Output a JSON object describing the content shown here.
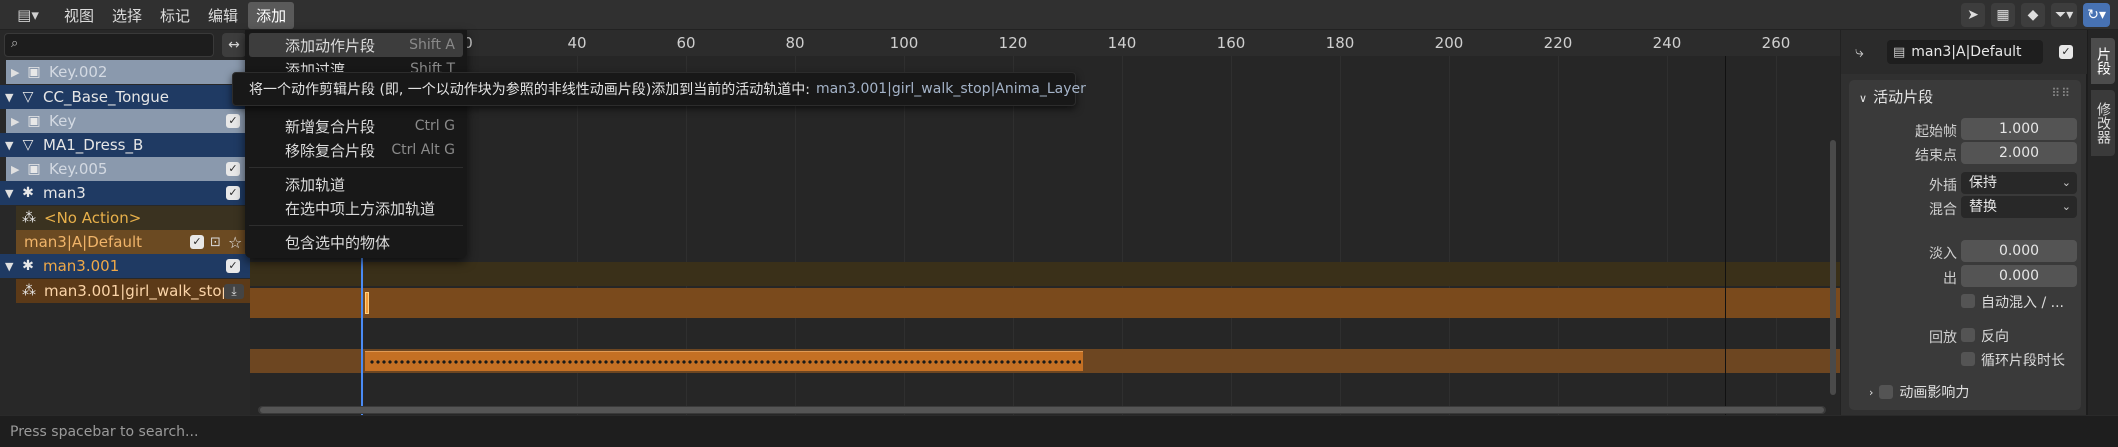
{
  "menubar": {
    "items": [
      "视图",
      "选择",
      "标记",
      "编辑",
      "添加"
    ]
  },
  "channels": {
    "rows": [
      {
        "label": "Key.002"
      },
      {
        "label": "CC_Base_Tongue"
      },
      {
        "label": "Key"
      },
      {
        "label": "MA1_Dress_B"
      },
      {
        "label": "Key.005"
      },
      {
        "label": "man3"
      },
      {
        "label": "<No Action>"
      },
      {
        "label": "man3|A|Default"
      },
      {
        "label": "man3.001"
      },
      {
        "label": "man3.001|girl_walk_stop|Ai"
      }
    ]
  },
  "ruler": {
    "ticks": [
      "0",
      "40",
      "60",
      "80",
      "100",
      "120",
      "140",
      "160",
      "180",
      "200",
      "220",
      "240",
      "260"
    ]
  },
  "dropdown": {
    "items": [
      {
        "label": "添加动作片段",
        "shortcut": "Shift A"
      },
      {
        "label": "添加过渡",
        "shortcut": "Shift T"
      },
      {
        "label": "新增复合片段",
        "shortcut": "Ctrl G"
      },
      {
        "label": "移除复合片段",
        "shortcut": "Ctrl Alt G"
      },
      {
        "label": "添加轨道",
        "shortcut": ""
      },
      {
        "label": "在选中项上方添加轨道",
        "shortcut": ""
      },
      {
        "label": "包含选中的物体",
        "shortcut": ""
      }
    ]
  },
  "tooltip": {
    "text": "将一个动作剪辑片段 (即, 一个以动作块为参照的非线性动画片段)添加到当前的活动轨道中:",
    "hint": "man3.001|girl_walk_stop|Anima_Layer"
  },
  "props": {
    "strip_name": "man3|A|Default",
    "panel_title": "活动片段",
    "frame_start_label": "起始帧",
    "frame_start": "1.000",
    "frame_end_label": "结束点",
    "frame_end": "2.000",
    "extrapolation_label": "外插",
    "extrapolation": "保持",
    "blend_label": "混合",
    "blend": "替换",
    "blend_in_label": "淡入",
    "blend_in": "0.000",
    "blend_out_label": "出",
    "blend_out": "0.000",
    "auto_blend_label": "自动混入 / ...",
    "playback_label": "回放",
    "reversed_label": "反向",
    "cyclic_label": "循环片段时长",
    "influence_label": "动画影响力"
  },
  "vtabs": [
    "片段",
    "修改器"
  ],
  "status": {
    "text": "Press spacebar to search..."
  }
}
